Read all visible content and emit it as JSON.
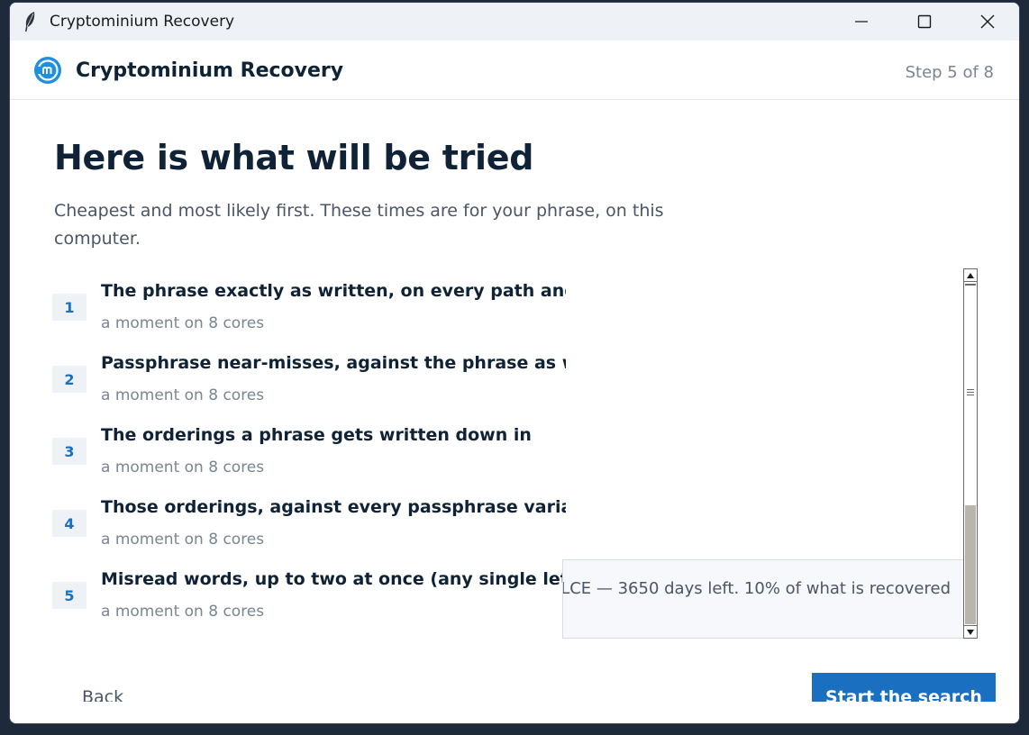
{
  "window": {
    "title": "Cryptominium Recovery"
  },
  "header": {
    "app_name": "Cryptominium Recovery",
    "step": "Step 5 of 8"
  },
  "main": {
    "heading": "Here is what will be tried",
    "subtitle": "Cheapest and most likely first. These times are for your phrase, on this computer.",
    "items": [
      {
        "num": "1",
        "title": "The phrase exactly as written, on every path and s",
        "meta": "a moment on 8 cores"
      },
      {
        "num": "2",
        "title": "Passphrase near-misses, against the phrase as wri",
        "meta": "a moment on 8 cores"
      },
      {
        "num": "3",
        "title": "The orderings a phrase gets written down in",
        "meta": "a moment on 8 cores"
      },
      {
        "num": "4",
        "title": "Those orderings, against every passphrase variant",
        "meta": "a moment on 8 cores"
      },
      {
        "num": "5",
        "title": "Misread words, up to two at once (any single lette",
        "meta": "a moment on 8 cores"
      }
    ],
    "panel_text": "LCE — 3650 days left. 10% of what is recovered"
  },
  "footer": {
    "back_label": "Back",
    "start_label": "Start the search"
  }
}
